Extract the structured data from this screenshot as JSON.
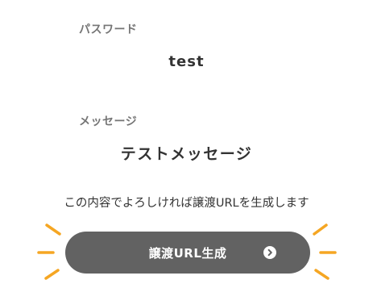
{
  "password": {
    "label": "パスワード",
    "value": "test"
  },
  "message": {
    "label": "メッセージ",
    "value": "テストメッセージ"
  },
  "confirm_text": "この内容でよろしければ譲渡URLを生成します",
  "generate_button": {
    "label": "譲渡URL生成",
    "icon": "arrow-right-circle-icon"
  },
  "colors": {
    "button_bg": "#626262",
    "accent": "#f5a623",
    "label": "#757575",
    "text": "#333333"
  }
}
